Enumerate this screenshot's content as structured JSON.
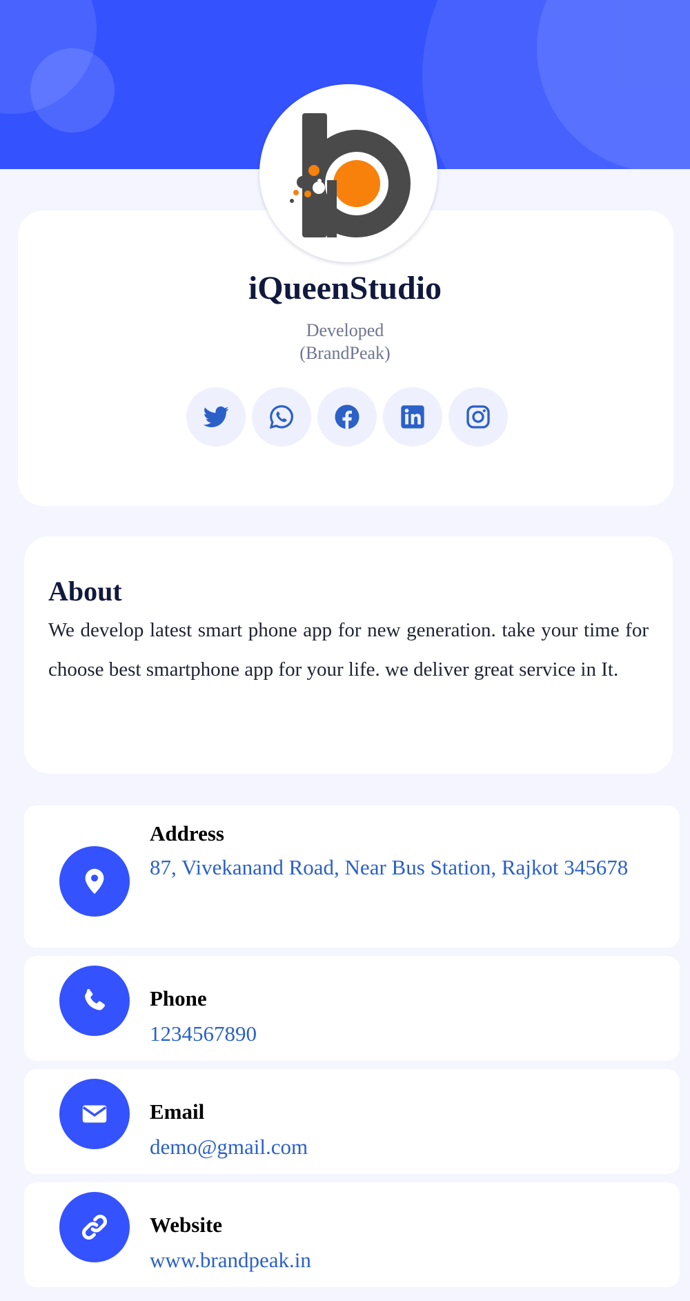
{
  "profile": {
    "name": "iQueenStudio",
    "tagline_line1": "Developed",
    "tagline_line2": "(BrandPeak)"
  },
  "socials": [
    {
      "name": "twitter-icon"
    },
    {
      "name": "whatsapp-icon"
    },
    {
      "name": "facebook-icon"
    },
    {
      "name": "linkedin-icon"
    },
    {
      "name": "instagram-icon"
    }
  ],
  "about": {
    "title": "About",
    "text": "We develop latest smart phone app for new generation. take your time for choose best smartphone app for your life. we deliver great service in It."
  },
  "contacts": {
    "address": {
      "label": "Address",
      "value": "87, Vivekanand Road, Near Bus Station, Rajkot 345678",
      "icon": "map-pin-icon"
    },
    "phone": {
      "label": "Phone",
      "value": "1234567890",
      "icon": "phone-icon"
    },
    "email": {
      "label": "Email",
      "value": "demo@gmail.com",
      "icon": "envelope-icon"
    },
    "website": {
      "label": "Website",
      "value": "www.brandpeak.in",
      "icon": "link-icon"
    }
  },
  "colors": {
    "primary": "#3452fe",
    "background": "#f4f5fe",
    "link": "#2a60c8",
    "heading": "#111a3d",
    "logo_dark": "#4a4a4a",
    "logo_orange": "#f7810a"
  }
}
